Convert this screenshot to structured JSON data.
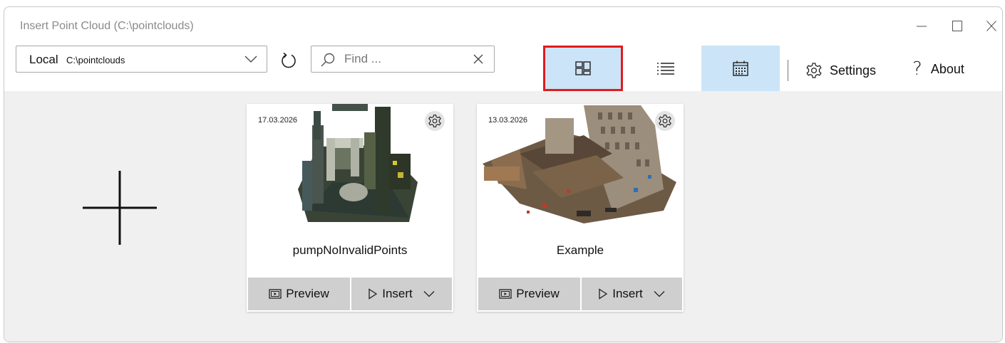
{
  "window": {
    "title": "Insert Point Cloud (C:\\pointclouds)"
  },
  "toolbar": {
    "location_label": "Local",
    "location_path": "C:\\pointclouds",
    "search_placeholder": "Find ...",
    "search_value": "",
    "settings_label": "Settings",
    "about_label": "About",
    "about_glyph": "?",
    "active_view": "tile",
    "accent_selected": "#cce4f7",
    "highlight_border": "#e21b1b"
  },
  "cards": [
    {
      "date": "17.03.2026",
      "name": "pumpNoInvalidPoints",
      "preview_label": "Preview",
      "insert_label": "Insert"
    },
    {
      "date": "13.03.2026",
      "name": "Example",
      "preview_label": "Preview",
      "insert_label": "Insert"
    }
  ]
}
